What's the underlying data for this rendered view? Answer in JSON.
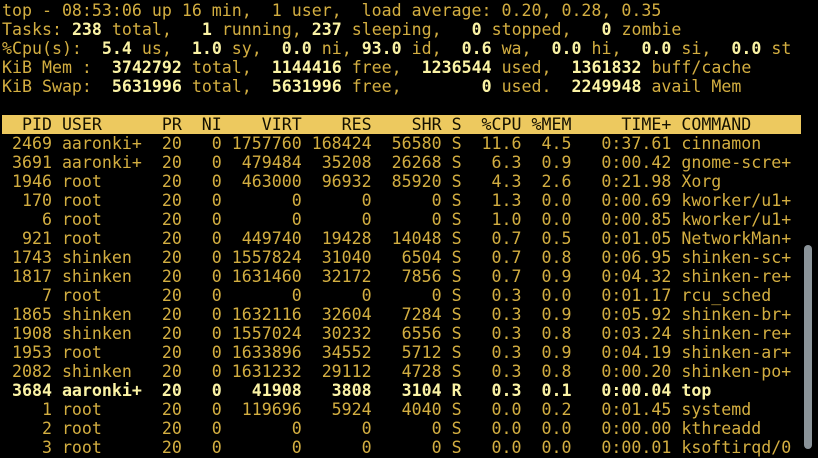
{
  "colors": {
    "background": "#000000",
    "foreground": "#d3ae41",
    "bold_text": "#fbf3a5",
    "header_bg": "#edc95f",
    "header_fg": "#141000",
    "scrollbar": "#8a9399"
  },
  "terminal": {
    "summary_lines": [
      {
        "name": "uptime-line",
        "segments": [
          {
            "text": "top - 08:53:06 up 16 min,  1 user,  load average: 0.20, 0.28, 0.35",
            "bold": false
          }
        ]
      },
      {
        "name": "tasks-line",
        "segments": [
          {
            "text": "Tasks: ",
            "bold": false
          },
          {
            "text": "238",
            "bold": true
          },
          {
            "text": " total,   ",
            "bold": false
          },
          {
            "text": "1",
            "bold": true
          },
          {
            "text": " running, ",
            "bold": false
          },
          {
            "text": "237",
            "bold": true
          },
          {
            "text": " sleeping,   ",
            "bold": false
          },
          {
            "text": "0",
            "bold": true
          },
          {
            "text": " stopped,   ",
            "bold": false
          },
          {
            "text": "0",
            "bold": true
          },
          {
            "text": " zombie",
            "bold": false
          }
        ]
      },
      {
        "name": "cpu-line",
        "segments": [
          {
            "text": "%Cpu(s): ",
            "bold": false
          },
          {
            "text": " 5.4",
            "bold": true
          },
          {
            "text": " us, ",
            "bold": false
          },
          {
            "text": " 1.0",
            "bold": true
          },
          {
            "text": " sy, ",
            "bold": false
          },
          {
            "text": " 0.0",
            "bold": true
          },
          {
            "text": " ni, ",
            "bold": false
          },
          {
            "text": "93.0",
            "bold": true
          },
          {
            "text": " id, ",
            "bold": false
          },
          {
            "text": " 0.6",
            "bold": true
          },
          {
            "text": " wa, ",
            "bold": false
          },
          {
            "text": " 0.0",
            "bold": true
          },
          {
            "text": " hi, ",
            "bold": false
          },
          {
            "text": " 0.0",
            "bold": true
          },
          {
            "text": " si, ",
            "bold": false
          },
          {
            "text": " 0.0",
            "bold": true
          },
          {
            "text": " st",
            "bold": false
          }
        ]
      },
      {
        "name": "mem-line",
        "segments": [
          {
            "text": "KiB Mem :  ",
            "bold": false
          },
          {
            "text": "3742792",
            "bold": true
          },
          {
            "text": " total,  ",
            "bold": false
          },
          {
            "text": "1144416",
            "bold": true
          },
          {
            "text": " free,  ",
            "bold": false
          },
          {
            "text": "1236544",
            "bold": true
          },
          {
            "text": " used,  ",
            "bold": false
          },
          {
            "text": "1361832",
            "bold": true
          },
          {
            "text": " buff/cache",
            "bold": false
          }
        ]
      },
      {
        "name": "swap-line",
        "segments": [
          {
            "text": "KiB Swap:  ",
            "bold": false
          },
          {
            "text": "5631996",
            "bold": true
          },
          {
            "text": " total,  ",
            "bold": false
          },
          {
            "text": "5631996",
            "bold": true
          },
          {
            "text": " free,        ",
            "bold": false
          },
          {
            "text": "0",
            "bold": true
          },
          {
            "text": " used.  ",
            "bold": false
          },
          {
            "text": "2249948",
            "bold": true
          },
          {
            "text": " avail Mem",
            "bold": false
          }
        ]
      }
    ],
    "table": {
      "header_width_chars": 80,
      "columns": [
        {
          "key": "pid",
          "label": "PID",
          "width": 5,
          "align": "right"
        },
        {
          "key": "user",
          "label": "USER",
          "width": 8,
          "align": "left"
        },
        {
          "key": "pr",
          "label": "PR",
          "width": 3,
          "align": "right"
        },
        {
          "key": "ni",
          "label": "NI",
          "width": 3,
          "align": "right"
        },
        {
          "key": "virt",
          "label": "VIRT",
          "width": 7,
          "align": "right"
        },
        {
          "key": "res",
          "label": "RES",
          "width": 6,
          "align": "right"
        },
        {
          "key": "shr",
          "label": "SHR",
          "width": 6,
          "align": "right"
        },
        {
          "key": "s",
          "label": "S",
          "width": 1,
          "align": "left"
        },
        {
          "key": "cpu",
          "label": "%CPU",
          "width": 5,
          "align": "right"
        },
        {
          "key": "mem",
          "label": "%MEM",
          "width": 4,
          "align": "right"
        },
        {
          "key": "time",
          "label": "TIME+",
          "width": 9,
          "align": "right"
        },
        {
          "key": "command",
          "label": "COMMAND",
          "width": 12,
          "align": "left"
        }
      ],
      "rows": [
        {
          "pid": "2469",
          "user": "aaronki+",
          "pr": "20",
          "ni": "0",
          "virt": "1757760",
          "res": "168424",
          "shr": "56580",
          "s": "S",
          "cpu": "11.6",
          "mem": "4.5",
          "time": "0:37.61",
          "command": "cinnamon",
          "highlight": false
        },
        {
          "pid": "3691",
          "user": "aaronki+",
          "pr": "20",
          "ni": "0",
          "virt": "479484",
          "res": "35208",
          "shr": "26268",
          "s": "S",
          "cpu": "6.3",
          "mem": "0.9",
          "time": "0:00.42",
          "command": "gnome-scre+",
          "highlight": false
        },
        {
          "pid": "1946",
          "user": "root",
          "pr": "20",
          "ni": "0",
          "virt": "463000",
          "res": "96932",
          "shr": "85920",
          "s": "S",
          "cpu": "4.3",
          "mem": "2.6",
          "time": "0:21.98",
          "command": "Xorg",
          "highlight": false
        },
        {
          "pid": "170",
          "user": "root",
          "pr": "20",
          "ni": "0",
          "virt": "0",
          "res": "0",
          "shr": "0",
          "s": "S",
          "cpu": "1.3",
          "mem": "0.0",
          "time": "0:00.69",
          "command": "kworker/u1+",
          "highlight": false
        },
        {
          "pid": "6",
          "user": "root",
          "pr": "20",
          "ni": "0",
          "virt": "0",
          "res": "0",
          "shr": "0",
          "s": "S",
          "cpu": "1.0",
          "mem": "0.0",
          "time": "0:00.85",
          "command": "kworker/u1+",
          "highlight": false
        },
        {
          "pid": "921",
          "user": "root",
          "pr": "20",
          "ni": "0",
          "virt": "449740",
          "res": "19428",
          "shr": "14048",
          "s": "S",
          "cpu": "0.7",
          "mem": "0.5",
          "time": "0:01.05",
          "command": "NetworkMan+",
          "highlight": false
        },
        {
          "pid": "1743",
          "user": "shinken",
          "pr": "20",
          "ni": "0",
          "virt": "1557824",
          "res": "31040",
          "shr": "6504",
          "s": "S",
          "cpu": "0.7",
          "mem": "0.8",
          "time": "0:06.95",
          "command": "shinken-sc+",
          "highlight": false
        },
        {
          "pid": "1817",
          "user": "shinken",
          "pr": "20",
          "ni": "0",
          "virt": "1631460",
          "res": "32172",
          "shr": "7856",
          "s": "S",
          "cpu": "0.7",
          "mem": "0.9",
          "time": "0:04.32",
          "command": "shinken-re+",
          "highlight": false
        },
        {
          "pid": "7",
          "user": "root",
          "pr": "20",
          "ni": "0",
          "virt": "0",
          "res": "0",
          "shr": "0",
          "s": "S",
          "cpu": "0.3",
          "mem": "0.0",
          "time": "0:01.17",
          "command": "rcu_sched",
          "highlight": false
        },
        {
          "pid": "1865",
          "user": "shinken",
          "pr": "20",
          "ni": "0",
          "virt": "1632116",
          "res": "32604",
          "shr": "7284",
          "s": "S",
          "cpu": "0.3",
          "mem": "0.9",
          "time": "0:05.92",
          "command": "shinken-br+",
          "highlight": false
        },
        {
          "pid": "1908",
          "user": "shinken",
          "pr": "20",
          "ni": "0",
          "virt": "1557024",
          "res": "30232",
          "shr": "6556",
          "s": "S",
          "cpu": "0.3",
          "mem": "0.8",
          "time": "0:03.24",
          "command": "shinken-re+",
          "highlight": false
        },
        {
          "pid": "1953",
          "user": "root",
          "pr": "20",
          "ni": "0",
          "virt": "1633896",
          "res": "34552",
          "shr": "5712",
          "s": "S",
          "cpu": "0.3",
          "mem": "0.9",
          "time": "0:04.19",
          "command": "shinken-ar+",
          "highlight": false
        },
        {
          "pid": "2082",
          "user": "shinken",
          "pr": "20",
          "ni": "0",
          "virt": "1631232",
          "res": "29112",
          "shr": "4728",
          "s": "S",
          "cpu": "0.3",
          "mem": "0.8",
          "time": "0:00.20",
          "command": "shinken-po+",
          "highlight": false
        },
        {
          "pid": "3684",
          "user": "aaronki+",
          "pr": "20",
          "ni": "0",
          "virt": "41908",
          "res": "3808",
          "shr": "3104",
          "s": "R",
          "cpu": "0.3",
          "mem": "0.1",
          "time": "0:00.04",
          "command": "top",
          "highlight": true
        },
        {
          "pid": "1",
          "user": "root",
          "pr": "20",
          "ni": "0",
          "virt": "119696",
          "res": "5924",
          "shr": "4040",
          "s": "S",
          "cpu": "0.0",
          "mem": "0.2",
          "time": "0:01.45",
          "command": "systemd",
          "highlight": false
        },
        {
          "pid": "2",
          "user": "root",
          "pr": "20",
          "ni": "0",
          "virt": "0",
          "res": "0",
          "shr": "0",
          "s": "S",
          "cpu": "0.0",
          "mem": "0.0",
          "time": "0:00.00",
          "command": "kthreadd",
          "highlight": false
        },
        {
          "pid": "3",
          "user": "root",
          "pr": "20",
          "ni": "0",
          "virt": "0",
          "res": "0",
          "shr": "0",
          "s": "S",
          "cpu": "0.0",
          "mem": "0.0",
          "time": "0:00.01",
          "command": "ksoftirqd/0",
          "highlight": false
        }
      ]
    }
  }
}
